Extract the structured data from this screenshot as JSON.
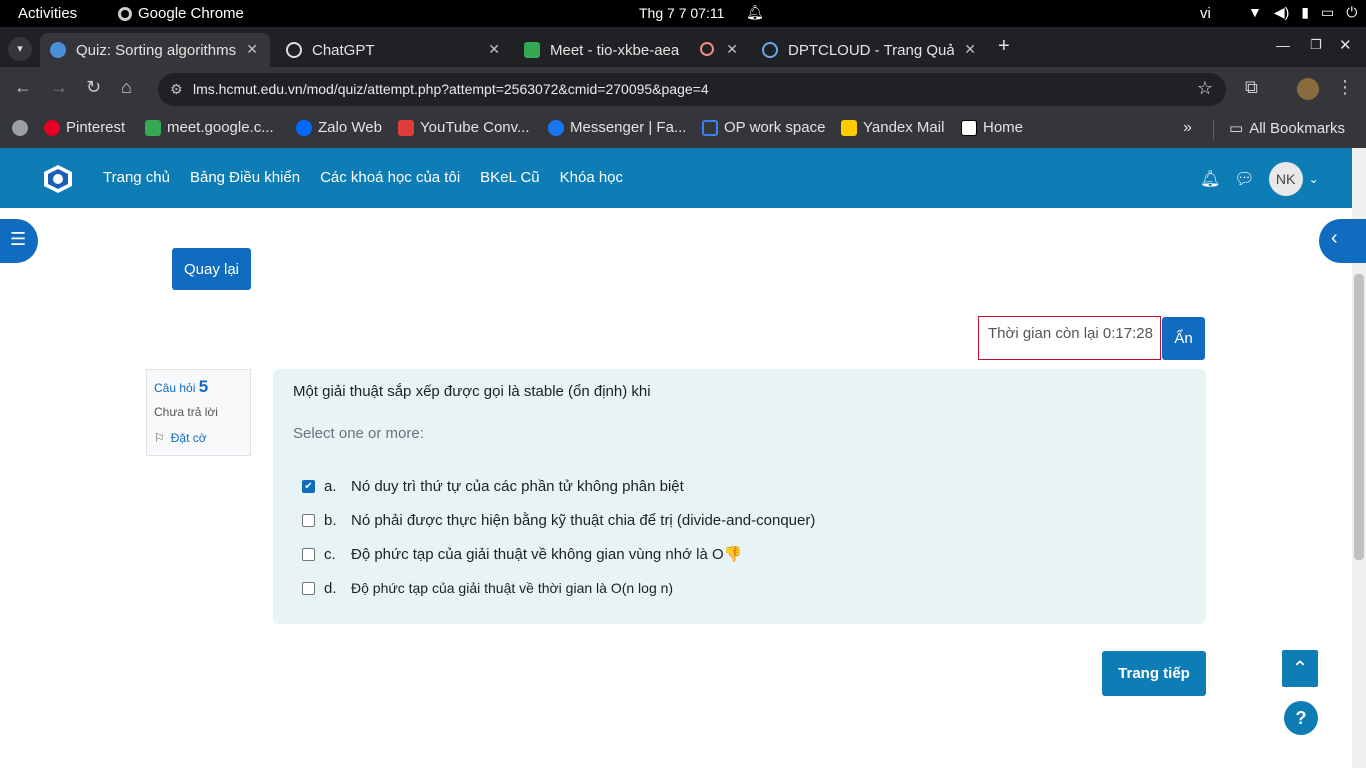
{
  "system": {
    "activities": "Activities",
    "app_name": "Google Chrome",
    "clock": "Thg 7 7  07:11",
    "language": "vi"
  },
  "tabs": [
    {
      "title": "Quiz: Sorting algorithms",
      "active": true
    },
    {
      "title": "ChatGPT",
      "active": false
    },
    {
      "title": "Meet - tio-xkbe-aea",
      "active": false
    },
    {
      "title": "DPTCLOUD - Trang Quản",
      "active": false
    }
  ],
  "address_bar": {
    "url": "lms.hcmut.edu.vn/mod/quiz/attempt.php?attempt=2563072&cmid=270095&page=4"
  },
  "bookmarks": [
    {
      "label": "Pinterest",
      "color": "#e60023"
    },
    {
      "label": "meet.google.c...",
      "color": "#34a853"
    },
    {
      "label": "Zalo Web",
      "color": "#0068ff"
    },
    {
      "label": "YouTube Conv...",
      "color": "#e03c3c"
    },
    {
      "label": "Messenger | Fa...",
      "color": "#1877f2"
    },
    {
      "label": "OP work space",
      "color": "#3b82f6"
    },
    {
      "label": "Yandex Mail",
      "color": "#ffcc00"
    },
    {
      "label": "Home",
      "color": "#ffffff"
    },
    {
      "label": "All Bookmarks",
      "color": "#e3e3e3"
    }
  ],
  "site_nav": {
    "items": [
      "Trang chủ",
      "Bảng Điều khiển",
      "Các khoá học của tôi",
      "BKeL Cũ",
      "Khóa học"
    ],
    "avatar_initials": "NK"
  },
  "buttons": {
    "back": "Quay lại",
    "hide": "Ẩn",
    "next_page": "Trang tiếp",
    "help": "?"
  },
  "timer": {
    "text": "Thời gian còn lại 0:17:28"
  },
  "question_info": {
    "label": "Câu hỏi",
    "number": "5",
    "state": "Chưa trả lời",
    "flag": "Đặt cờ"
  },
  "question": {
    "text": "Một giải thuật sắp xếp được gọi là stable (ổn định) khi",
    "prompt": "Select one or more:",
    "answers": [
      {
        "letter": "a.",
        "text": "Nó duy trì thứ tự của các phần tử không phân biệt",
        "checked": true
      },
      {
        "letter": "b.",
        "text": "Nó phải được thực hiện bằng kỹ thuật chia để trị (divide-and-conquer)",
        "checked": false
      },
      {
        "letter": "c.",
        "text": "Độ phức tạp của giải thuật về không gian vùng nhớ là O👎",
        "checked": false
      },
      {
        "letter": "d.",
        "text": "Độ phức tạp của giải thuật về thời gian là O(n log n)",
        "checked": false
      }
    ]
  },
  "colors": {
    "brand": "#0f7db5",
    "primary_button": "#0f6cbf",
    "question_bg": "#e7f3f5",
    "timer_border": "#c8102e"
  }
}
